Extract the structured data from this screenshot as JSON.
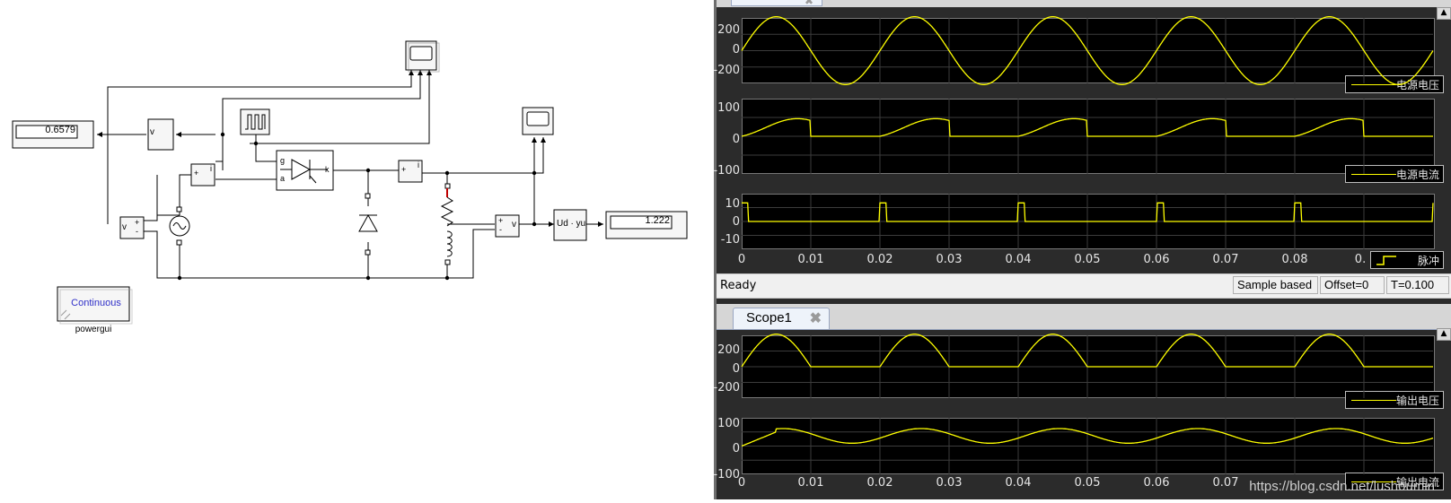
{
  "model": {
    "display1_value": "0.6579",
    "display2_value": "1.222",
    "powergui_mode": "Continuous",
    "powergui_name": "powergui",
    "vm_label": "v",
    "vm2_label": "v",
    "ud_label": "Ud · yu",
    "thyristor_g": "g",
    "thyristor_a": "a",
    "thyristor_k": "k",
    "plus": "+",
    "minus": "-",
    "current_i": "i"
  },
  "scope_top": {
    "status": "Ready",
    "sample_mode": "Sample based",
    "offset": "Offset=0",
    "time": "T=0.100",
    "plots": [
      {
        "legend": "电源电压",
        "yticks": [
          "200",
          "0",
          "-200"
        ]
      },
      {
        "legend": "电源电流",
        "yticks": [
          "100",
          "0",
          "-100"
        ]
      },
      {
        "legend": "脉冲",
        "yticks": [
          "10",
          "0",
          "-10"
        ]
      }
    ],
    "xticks": [
      "0",
      "0.01",
      "0.02",
      "0.03",
      "0.04",
      "0.05",
      "0.06",
      "0.07",
      "0.08",
      "0."
    ]
  },
  "scope1": {
    "tab_label": "Scope1",
    "close_glyph": "✖",
    "plots": [
      {
        "legend": "输出电压",
        "yticks": [
          "200",
          "0",
          "-200"
        ]
      },
      {
        "legend": "输出电流",
        "yticks": [
          "100",
          "0",
          "-100"
        ]
      }
    ],
    "xticks": [
      "0",
      "0.01",
      "0.02",
      "0.03",
      "0.04",
      "0.05",
      "0.06",
      "0.07"
    ]
  },
  "watermark": "https://blog.csdn.net/lushoumin",
  "colors": {
    "trace": "#ffff00",
    "axis_bg": "#000000",
    "window_bg": "#2b2b2b"
  }
}
